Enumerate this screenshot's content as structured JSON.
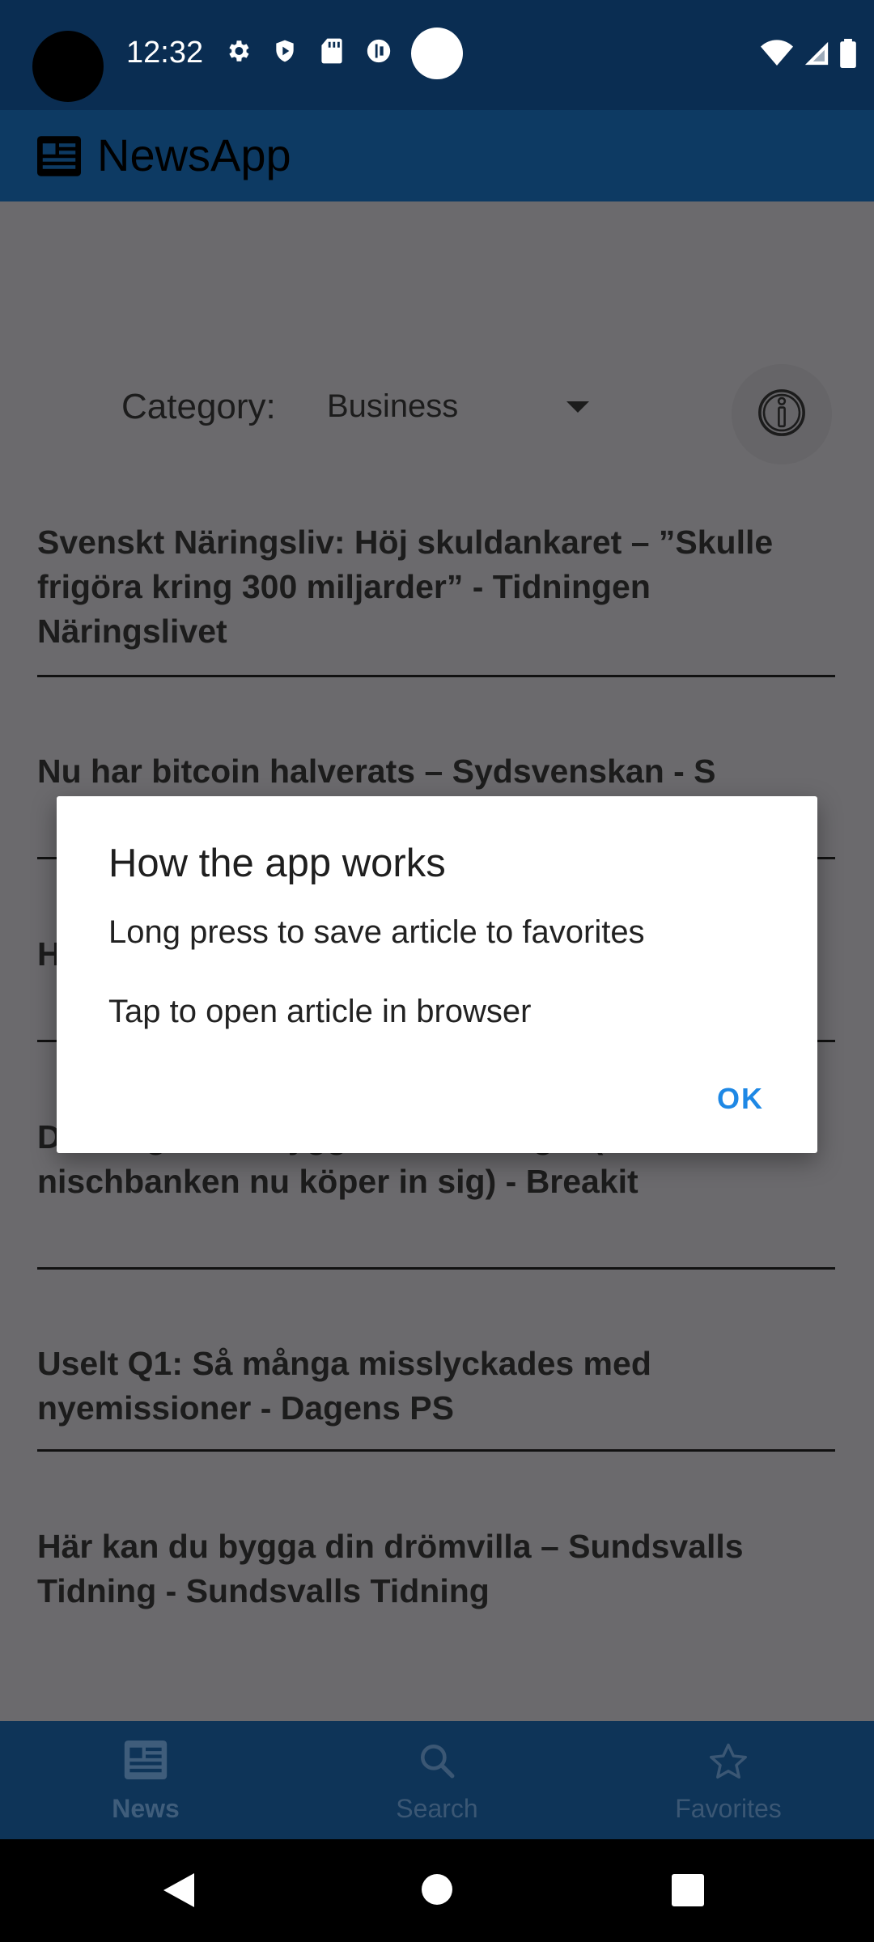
{
  "status_bar": {
    "time": "12:32"
  },
  "app_bar": {
    "title": "NewsApp"
  },
  "filter": {
    "category_label": "Category:",
    "category_value": "Business"
  },
  "articles": [
    {
      "title": "Svenskt Näringsliv: Höj skuldankaret – ”Skulle frigöra kring 300 miljarder” - Tidningen Näringslivet"
    },
    {
      "title": "Nu har bitcoin halverats – Sydsvenskan - S"
    },
    {
      "title": "H b"
    },
    {
      "title": "D i Norge – så byggde hon bolaget (där nischbanken nu köper in sig) - Breakit"
    },
    {
      "title": "Uselt Q1: Så många misslyckades med nyemissioner - Dagens PS"
    },
    {
      "title": "Här kan du bygga din drömvilla – Sundsvalls Tidning - Sundsvalls Tidning"
    }
  ],
  "dialog": {
    "title": "How the app works",
    "line1": "Long press to save article to favorites",
    "line2": "Tap to open article in browser",
    "ok": "OK"
  },
  "bottom_nav": [
    {
      "label": "News",
      "icon": "news-icon",
      "active": true
    },
    {
      "label": "Search",
      "icon": "search-icon",
      "active": false
    },
    {
      "label": "Favorites",
      "icon": "star-icon",
      "active": false
    }
  ],
  "colors": {
    "status_bar": "#0a2d52",
    "app_bar": "#0d3a63",
    "scrim": "#6b6a6d",
    "accent": "#1e88e5",
    "nav_bar": "#0e3458"
  }
}
